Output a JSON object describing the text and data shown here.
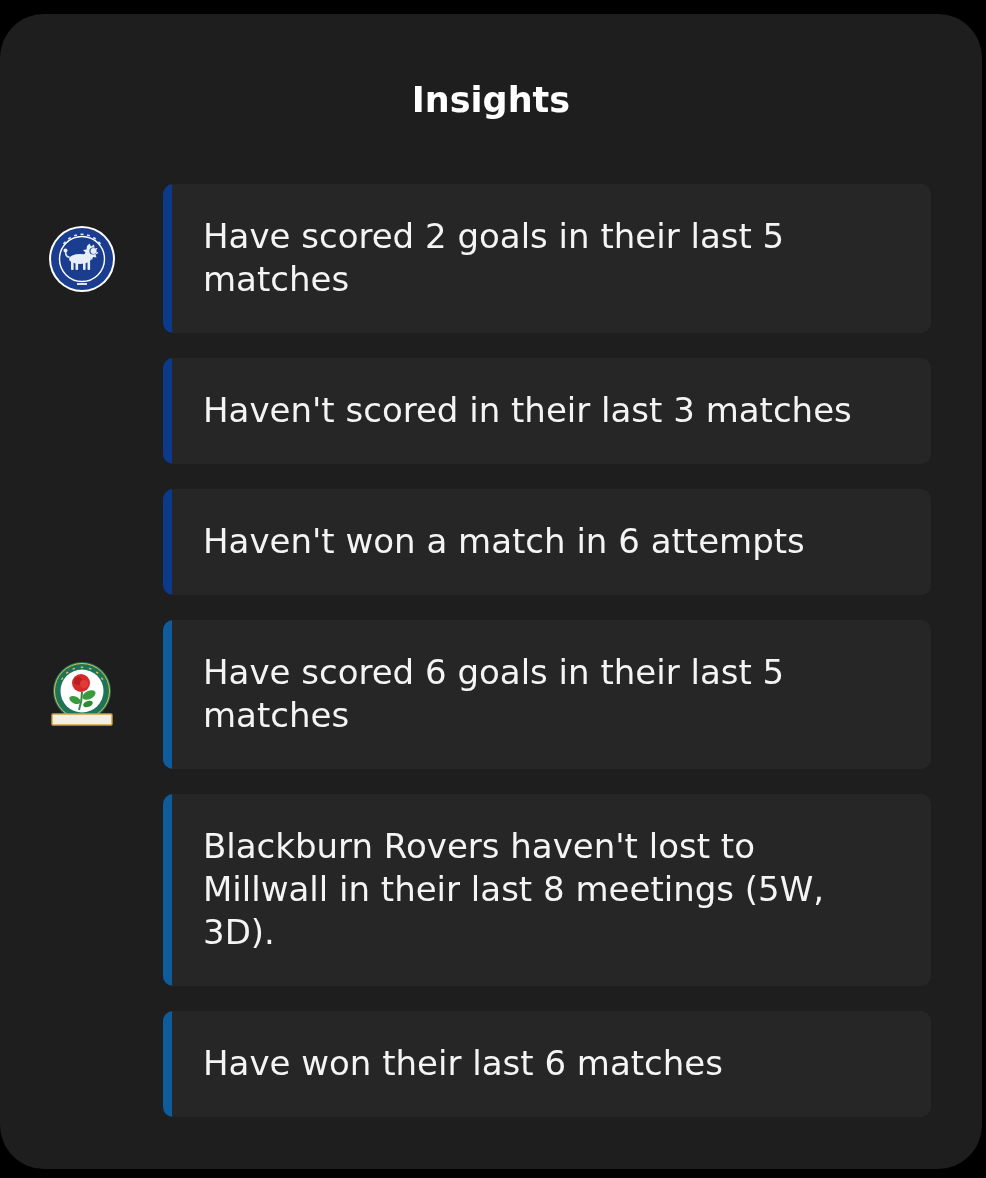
{
  "panel": {
    "title": "Insights"
  },
  "teams": [
    {
      "kind": "lion",
      "color": "#0b3a8a",
      "insights": [
        "Have scored 2 goals in their last 5 matches",
        "Haven't scored in their last 3 matches",
        "Haven't won a match in 6 attempts"
      ]
    },
    {
      "kind": "rose",
      "color": "#0f5c9c",
      "insights": [
        "Have scored 6 goals in their last 5 matches",
        "Blackburn Rovers haven't lost to Millwall in their last 8 meetings (5W, 3D).",
        "Have won their last 6 matches"
      ]
    }
  ]
}
